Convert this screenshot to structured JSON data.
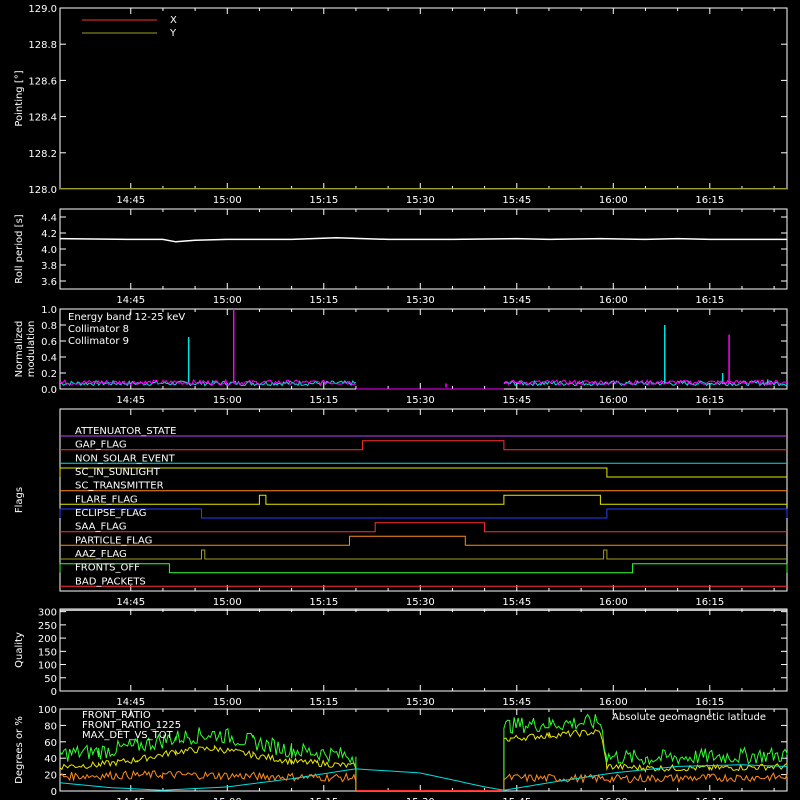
{
  "time_axis": {
    "tick_labels": [
      "14:45",
      "15:00",
      "15:15",
      "15:30",
      "15:45",
      "16:00",
      "16:15"
    ],
    "tick_minutes": [
      885,
      900,
      915,
      930,
      945,
      960,
      975
    ],
    "range_minutes": [
      874,
      987
    ]
  },
  "colors": {
    "red": "#ff3030",
    "yellow": "#e8e800",
    "white": "#ffffff",
    "cyan": "#00e0e0",
    "magenta": "#ff00ff",
    "green": "#30ff30",
    "orange": "#ff8c1a",
    "blue": "#2040ff",
    "purple": "#c040ff",
    "olive": "#a0a020"
  },
  "chart_data": [
    {
      "type": "line",
      "ylabel": "Pointing [°]",
      "ylim": [
        128.0,
        129.0
      ],
      "yticks": [
        "128.0",
        "128.2",
        "128.4",
        "128.6",
        "128.8",
        "129.0"
      ],
      "ytick_values": [
        128.0,
        128.2,
        128.4,
        128.6,
        128.8,
        129.0
      ],
      "series": [
        {
          "name": "X",
          "color": "#ff3030",
          "x": [
            874,
            987
          ],
          "y": [
            128.0,
            128.0
          ]
        },
        {
          "name": "Y",
          "color": "#a0a020",
          "x": [
            874,
            987
          ],
          "y": [
            128.0,
            128.0
          ]
        }
      ]
    },
    {
      "type": "line",
      "ylabel": "Roll period [s]",
      "ylim": [
        3.5,
        4.5
      ],
      "yticks": [
        "3.6",
        "3.8",
        "4.0",
        "4.2",
        "4.4"
      ],
      "ytick_values": [
        3.6,
        3.8,
        4.0,
        4.2,
        4.4
      ],
      "series": [
        {
          "color": "#ffffff",
          "x": [
            874,
            885,
            890,
            892,
            895,
            900,
            910,
            917,
            925,
            935,
            945,
            950,
            958,
            965,
            970,
            975,
            980,
            987
          ],
          "y": [
            4.13,
            4.12,
            4.12,
            4.09,
            4.11,
            4.12,
            4.12,
            4.14,
            4.12,
            4.12,
            4.13,
            4.12,
            4.13,
            4.12,
            4.13,
            4.12,
            4.12,
            4.12
          ]
        }
      ]
    },
    {
      "type": "line",
      "ylabel": "Normalized modulation",
      "ylim": [
        0,
        1.0
      ],
      "yticks": [
        "0.0",
        "0.2",
        "0.4",
        "0.6",
        "0.8",
        "1.0"
      ],
      "ytick_values": [
        0.0,
        0.2,
        0.4,
        0.6,
        0.8,
        1.0
      ],
      "legend": [
        "Energy band  12-25 keV",
        "Collimator 8",
        "Collimator 9"
      ],
      "series": [
        {
          "name": "Collimator 8",
          "color": "#00e0e0",
          "segments": [
            [
              874,
              920
            ],
            [
              943,
              987
            ]
          ],
          "base": 0.06,
          "spikes": [
            [
              894,
              0.65
            ],
            [
              968,
              0.8
            ],
            [
              977,
              0.2
            ],
            [
              984,
              0.12
            ]
          ]
        },
        {
          "name": "Collimator 9",
          "color": "#ff00ff",
          "segments": [
            [
              874,
              920
            ],
            [
              943,
              987
            ]
          ],
          "base": 0.07,
          "spikes": [
            [
              901,
              1.0
            ],
            [
              978,
              0.68
            ],
            [
              934,
              0.02
            ]
          ]
        }
      ],
      "gap_line": {
        "color": "#ff00ff",
        "x": [
          920,
          943
        ],
        "y": 0.0
      }
    },
    {
      "type": "line",
      "ylabel": "Flags",
      "flags": [
        {
          "label": "ATTENUATOR_STATE",
          "color": "#c040ff",
          "high": []
        },
        {
          "label": "GAP_FLAG",
          "color": "#ff3030",
          "high": [
            [
              921,
              943
            ]
          ]
        },
        {
          "label": "NON_SOLAR_EVENT",
          "color": "#00e0e0",
          "high": []
        },
        {
          "label": "SC_IN_SUNLIGHT",
          "color": "#e8e800",
          "high": [
            [
              874,
              959
            ]
          ],
          "low_before": 896
        },
        {
          "label": "SC_TRANSMITTER",
          "color": "#ff8c1a",
          "high": []
        },
        {
          "label": "FLARE_FLAG",
          "color": "#e8e800",
          "high": [
            [
              905,
              906
            ],
            [
              943,
              958
            ]
          ]
        },
        {
          "label": "ECLIPSE_FLAG",
          "color": "#2040ff",
          "high": [
            [
              874,
              896
            ],
            [
              959,
              987
            ]
          ]
        },
        {
          "label": "SAA_FLAG",
          "color": "#ff3030",
          "high": [
            [
              923,
              940
            ]
          ]
        },
        {
          "label": "PARTICLE_FLAG",
          "color": "#ff8c1a",
          "high": [
            [
              919,
              937
            ]
          ]
        },
        {
          "label": "AAZ_FLAG",
          "color": "#a0a020",
          "high": [
            [
              896,
              896.5
            ],
            [
              958.5,
              959
            ]
          ]
        },
        {
          "label": "FRONTS_OFF",
          "color": "#30ff30",
          "high": [
            [
              874,
              891
            ],
            [
              963,
              987
            ]
          ]
        },
        {
          "label": "BAD_PACKETS",
          "color": "#ff3030",
          "high": []
        }
      ]
    },
    {
      "type": "line",
      "ylabel": "Quality",
      "ylim": [
        0,
        310
      ],
      "yticks": [
        "0",
        "50",
        "100",
        "150",
        "200",
        "250",
        "300"
      ],
      "ytick_values": [
        0,
        50,
        100,
        150,
        200,
        250,
        300
      ],
      "series": [
        {
          "color": "#ffffff",
          "x": [
            874,
            987
          ],
          "y": [
            305,
            305
          ]
        }
      ]
    },
    {
      "type": "line",
      "ylabel": "Degrees or %",
      "ylim": [
        0,
        100
      ],
      "yticks": [
        "0",
        "20",
        "40",
        "60",
        "80",
        "100"
      ],
      "ytick_values": [
        0,
        20,
        40,
        60,
        80,
        100
      ],
      "legend_left": [
        "FRONT_RATIO",
        "FRONT_RATIO_1225",
        "MAX_DET_VS_TOT"
      ],
      "legend_right": "Absolute geomagnetic latitude",
      "series": [
        {
          "name": "FRONT_RATIO",
          "color": "#e8e800",
          "x": [
            874,
            880,
            886,
            892,
            898,
            904,
            910,
            914,
            920,
            943,
            944,
            950,
            958,
            959,
            965,
            975,
            987
          ],
          "y": [
            30,
            32,
            38,
            48,
            52,
            44,
            36,
            34,
            30,
            62,
            64,
            68,
            72,
            30,
            28,
            28,
            30
          ]
        },
        {
          "name": "FRONT_RATIO_1225",
          "color": "#30ff30",
          "x": [
            874,
            880,
            886,
            892,
            898,
            904,
            910,
            914,
            920,
            943,
            944,
            950,
            958,
            959,
            965,
            975,
            987
          ],
          "y": [
            45,
            48,
            55,
            65,
            70,
            60,
            50,
            47,
            42,
            78,
            80,
            82,
            84,
            42,
            40,
            42,
            44
          ]
        },
        {
          "name": "MAX_DET_VS_TOT",
          "color": "#ff8c1a",
          "x": [
            874,
            890,
            905,
            920,
            943,
            960,
            975,
            987
          ],
          "y": [
            18,
            20,
            18,
            16,
            16,
            15,
            16,
            17
          ]
        },
        {
          "name": "Absolute geomagnetic latitude",
          "color": "#00e0e0",
          "x": [
            874,
            882,
            890,
            900,
            910,
            920,
            930,
            940,
            943,
            950,
            960,
            970,
            980,
            987
          ],
          "y": [
            10,
            4,
            1,
            5,
            15,
            27,
            22,
            5,
            1,
            10,
            22,
            30,
            32,
            30
          ]
        }
      ],
      "gap_line": {
        "color": "#ff3030",
        "x": [
          920,
          943
        ],
        "y": 0
      }
    }
  ]
}
